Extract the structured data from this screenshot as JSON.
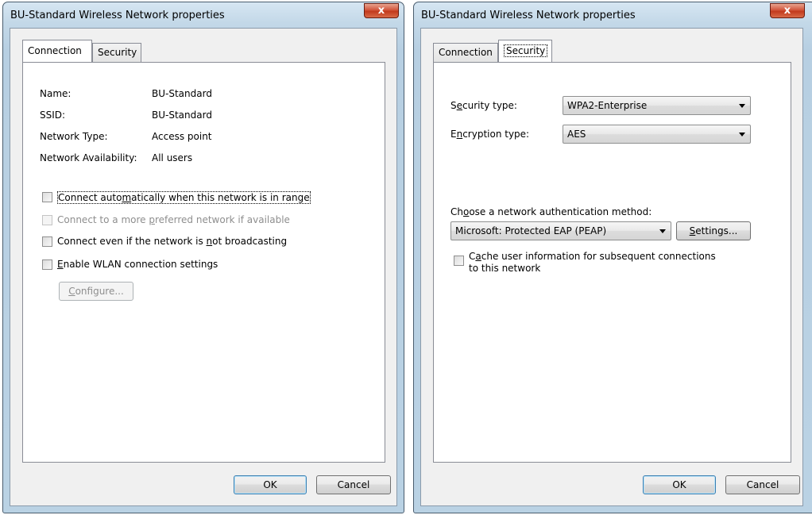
{
  "left_window": {
    "title": "BU-Standard Wireless Network properties",
    "close_label": "x",
    "tabs": [
      {
        "pre": "",
        "key": "",
        "post": "Connection"
      },
      {
        "pre": "",
        "key": "",
        "post": "Security"
      }
    ],
    "info": [
      {
        "label": "Name:",
        "value": "BU-Standard"
      },
      {
        "label": "SSID:",
        "value": "BU-Standard"
      },
      {
        "label": "Network Type:",
        "value": "Access point"
      },
      {
        "label": "Network Availability:",
        "value": "All users"
      }
    ],
    "checkboxes": [
      {
        "pre": "Connect auto",
        "key": "m",
        "post": "atically when this network is in range",
        "checked": false,
        "enabled": true
      },
      {
        "pre": "Connect to a more ",
        "key": "p",
        "post": "referred network if available",
        "checked": false,
        "enabled": false
      },
      {
        "pre": "Connect even if the network is ",
        "key": "n",
        "post": "ot broadcasting",
        "checked": false,
        "enabled": true
      },
      {
        "pre": "",
        "key": "E",
        "post": "nable WLAN connection settings",
        "checked": false,
        "enabled": true
      }
    ],
    "configure_button": {
      "pre": "",
      "key": "C",
      "post": "onfigure..."
    },
    "ok_label": "OK",
    "cancel_label": "Cancel"
  },
  "right_window": {
    "title": "BU-Standard Wireless Network properties",
    "close_label": "x",
    "tabs": [
      {
        "label": "Connection"
      },
      {
        "label": "Security"
      }
    ],
    "security_type": {
      "pre": "S",
      "key": "e",
      "post": "curity type:",
      "value": "WPA2-Enterprise"
    },
    "encryption_type": {
      "pre": "E",
      "key": "n",
      "post": "cryption type:",
      "value": "AES"
    },
    "auth_method": {
      "pre": "Ch",
      "key": "o",
      "post": "ose a network authentication method:",
      "value": "Microsoft: Protected EAP (PEAP)"
    },
    "settings_button": {
      "pre": "",
      "key": "S",
      "post": "ettings..."
    },
    "cache_checkbox": {
      "pre": "C",
      "key": "a",
      "post": "che user information for subsequent connections",
      "line2": "to this network",
      "checked": false
    },
    "ok_label": "OK",
    "cancel_label": "Cancel"
  }
}
